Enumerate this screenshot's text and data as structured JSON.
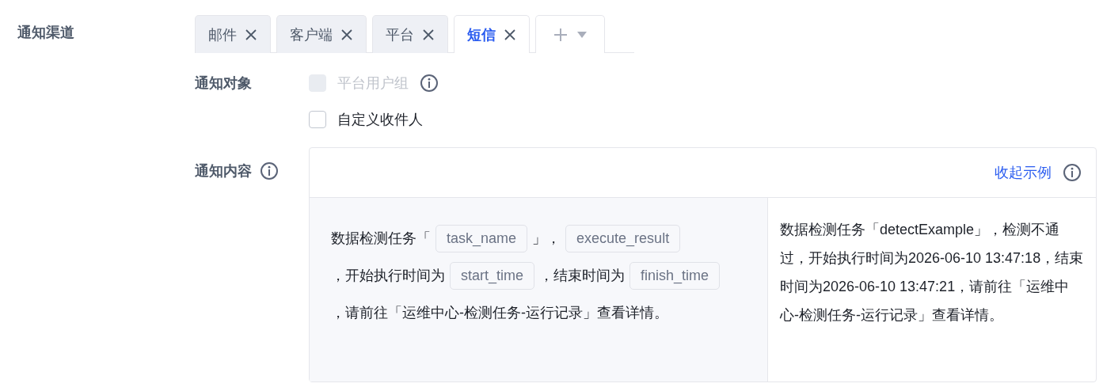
{
  "field_label": "通知渠道",
  "tabs": [
    {
      "label": "邮件",
      "selected": false
    },
    {
      "label": "客户端",
      "selected": false
    },
    {
      "label": "平台",
      "selected": false
    },
    {
      "label": "短信",
      "selected": true
    }
  ],
  "recipients": {
    "label": "通知对象",
    "options": [
      {
        "label": "平台用户组",
        "checked": false,
        "disabled": true,
        "info": true
      },
      {
        "label": "自定义收件人",
        "checked": false,
        "disabled": false,
        "info": false
      }
    ]
  },
  "content": {
    "label": "通知内容",
    "toggle_link": "收起示例",
    "template": [
      {
        "kind": "text",
        "text": "数据检测任务「"
      },
      {
        "kind": "var",
        "text": "task_name"
      },
      {
        "kind": "text",
        "text": "」，"
      },
      {
        "kind": "var",
        "text": "execute_result"
      },
      {
        "kind": "text",
        "text": "，开始执行时间为"
      },
      {
        "kind": "var",
        "text": "start_time"
      },
      {
        "kind": "text",
        "text": "，结束时间为"
      },
      {
        "kind": "var",
        "text": "finish_time"
      },
      {
        "kind": "text",
        "text": "，请前往「运维中心-检测任务-运行记"
      },
      {
        "kind": "text",
        "text": "录」查看详情。"
      }
    ],
    "example": "数据检测任务「detectExample」，检测不通过，开始执行时间为2026-06-10 13:47:18，结束时间为2026-06-10 13:47:21，请前往「运维中心-检测任务-运行记录」查看详情。"
  }
}
